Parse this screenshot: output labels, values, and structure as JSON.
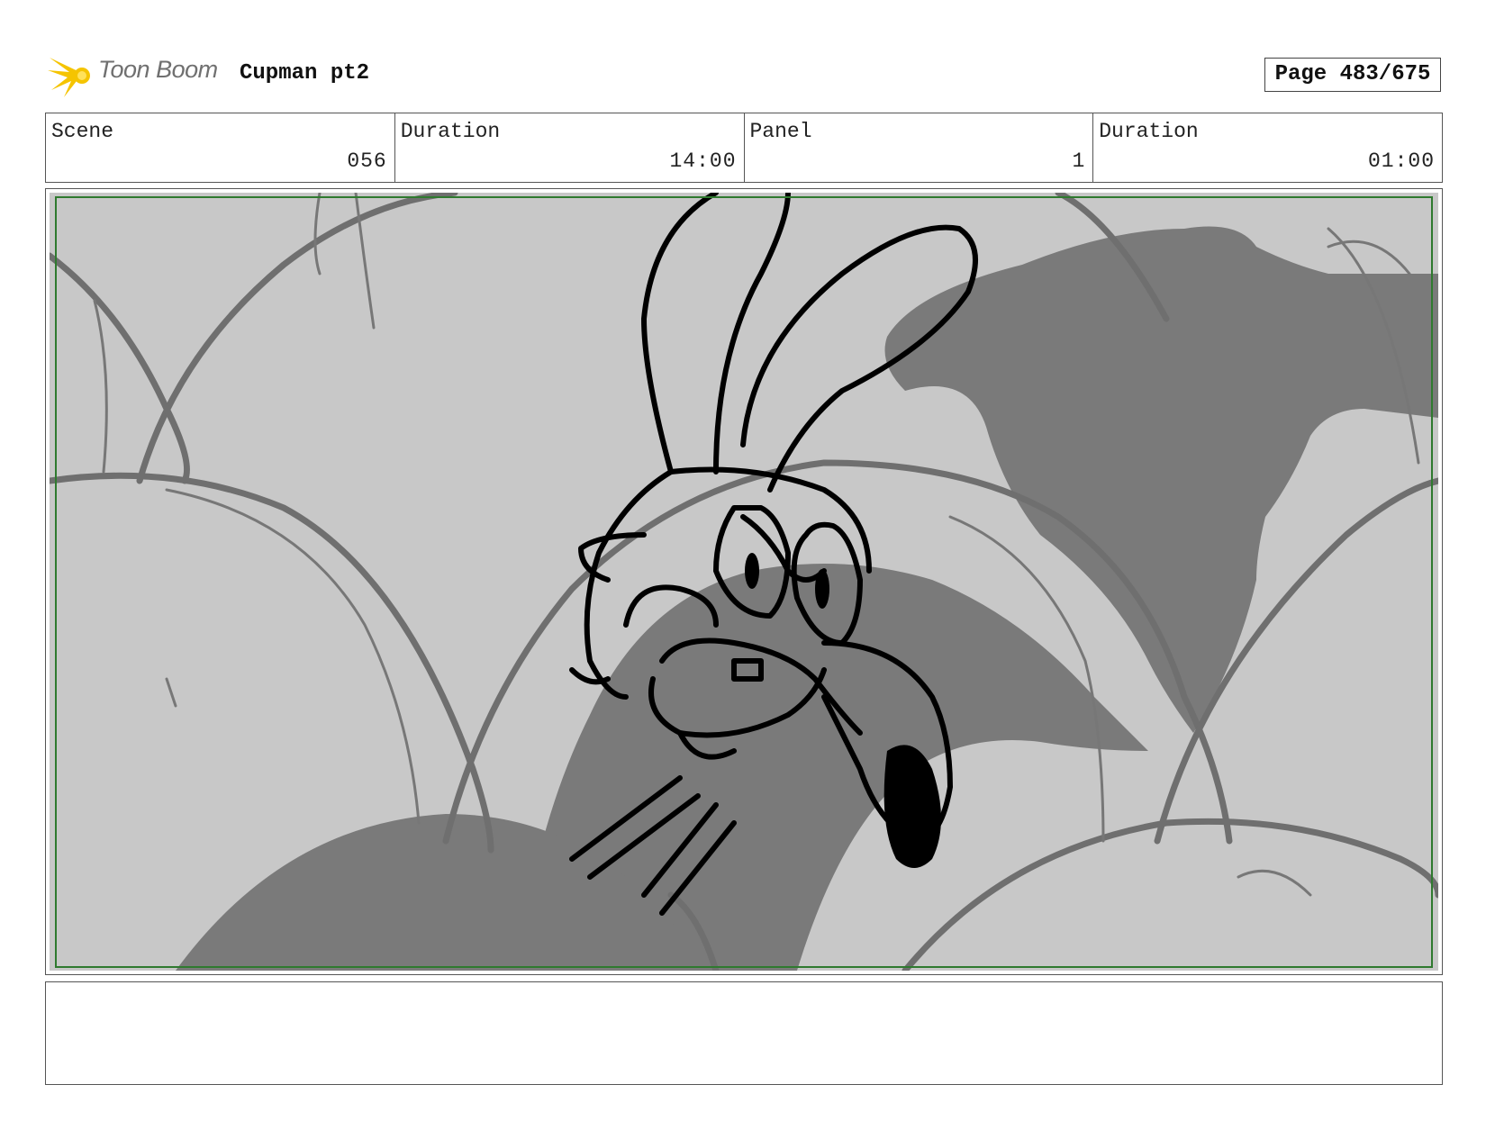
{
  "header": {
    "logo_text": "Toon Boom",
    "project_title": "Cupman pt2",
    "page_label": "Page 483/675"
  },
  "info": [
    {
      "label": "Scene",
      "value": "056"
    },
    {
      "label": "Duration",
      "value": "14:00"
    },
    {
      "label": "Panel",
      "value": "1"
    },
    {
      "label": "Duration",
      "value": "01:00"
    }
  ],
  "panel": {
    "image": "storyboard-sketch-cartoon-character-angry",
    "colors": {
      "background": "#c8c8c8",
      "shadow": "#7a7a7a",
      "guide": "#6f6f6f",
      "ink": "#000000",
      "safe_frame": "#2f7a2f"
    }
  },
  "notes": {
    "text": ""
  }
}
